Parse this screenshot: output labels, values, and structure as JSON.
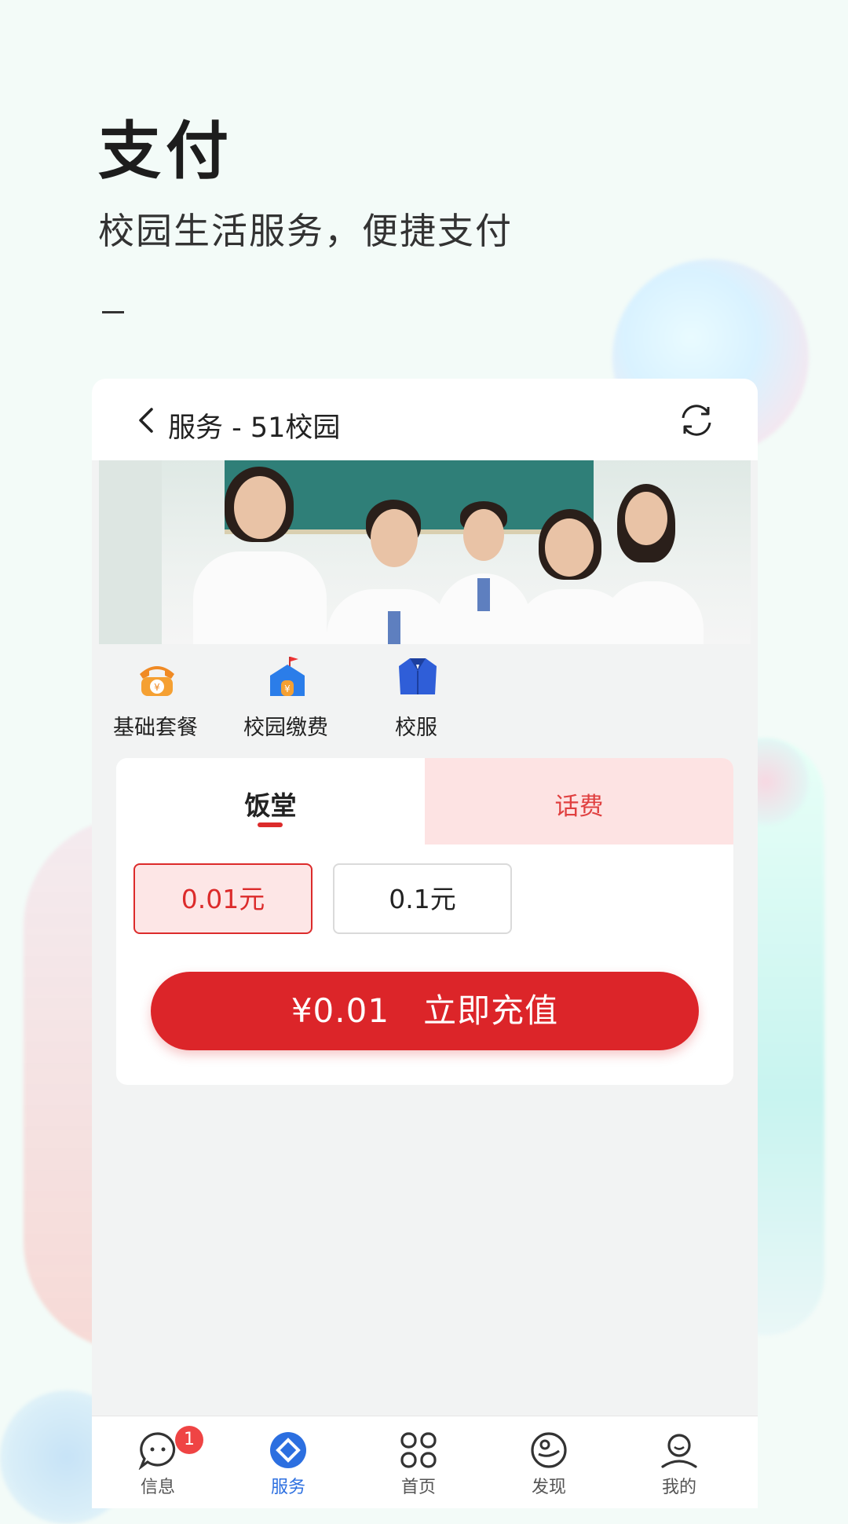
{
  "hero": {
    "title": "支付",
    "subtitle": "校园生活服务，便捷支付"
  },
  "topbar": {
    "title": "服务 - 51校园"
  },
  "quick_actions": [
    {
      "label": "基础套餐",
      "icon": "phone-yuan-icon"
    },
    {
      "label": "校园缴费",
      "icon": "school-yuan-icon"
    },
    {
      "label": "校服",
      "icon": "uniform-icon"
    }
  ],
  "tabs": [
    {
      "label": "饭堂",
      "active": true
    },
    {
      "label": "话费",
      "active": false
    }
  ],
  "amounts": [
    {
      "label": "0.01元",
      "selected": true
    },
    {
      "label": "0.1元",
      "selected": false
    }
  ],
  "pay_button": {
    "price": "¥0.01",
    "label": "立即充值"
  },
  "tabbar": [
    {
      "label": "信息",
      "icon": "chat-icon",
      "badge": "1"
    },
    {
      "label": "服务",
      "icon": "service-diamond-icon",
      "active": true
    },
    {
      "label": "首页",
      "icon": "grid-icon"
    },
    {
      "label": "发现",
      "icon": "discover-icon"
    },
    {
      "label": "我的",
      "icon": "profile-icon"
    }
  ],
  "colors": {
    "accent_red": "#dc2529",
    "active_blue": "#2c6fe0",
    "tab_inactive_bg": "#fde3e3"
  }
}
